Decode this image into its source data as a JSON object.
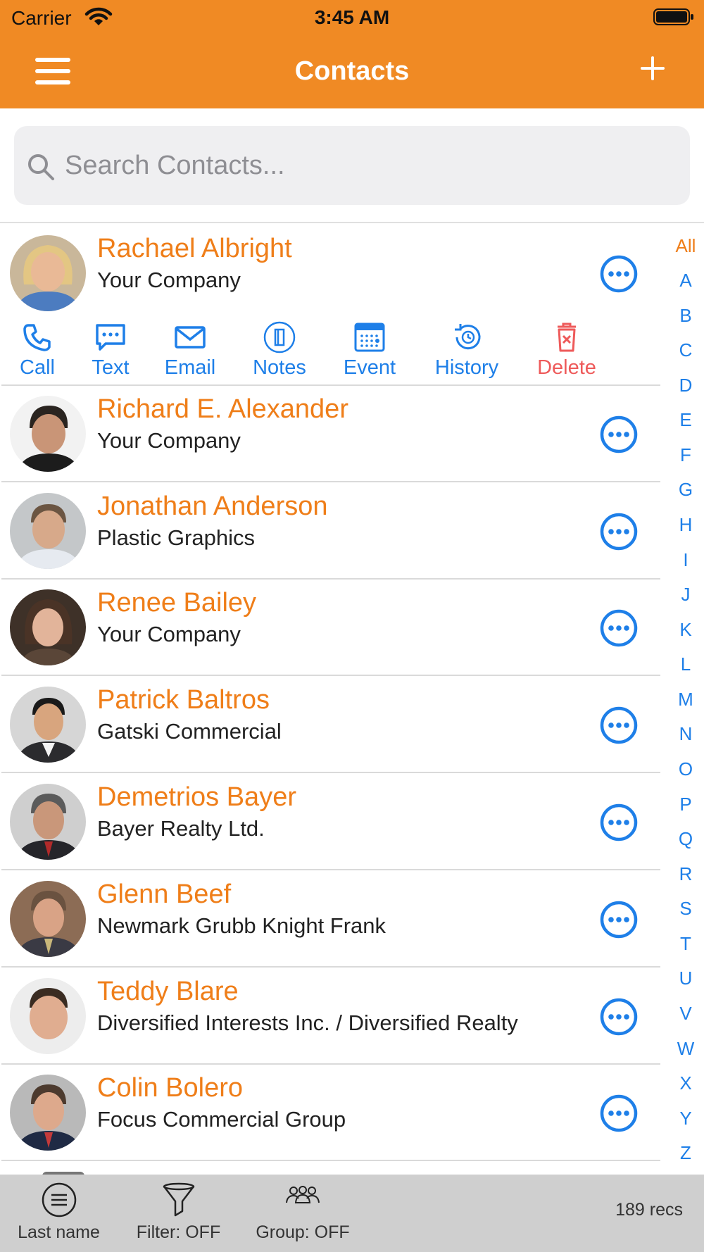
{
  "status_bar": {
    "carrier": "Carrier",
    "time": "3:45 AM"
  },
  "nav": {
    "title": "Contacts"
  },
  "search": {
    "placeholder": "Search Contacts..."
  },
  "expanded_actions": [
    {
      "label": "Call",
      "icon": "phone-icon"
    },
    {
      "label": "Text",
      "icon": "message-icon"
    },
    {
      "label": "Email",
      "icon": "envelope-icon"
    },
    {
      "label": "Notes",
      "icon": "notes-icon"
    },
    {
      "label": "Event",
      "icon": "calendar-icon"
    },
    {
      "label": "History",
      "icon": "history-icon"
    },
    {
      "label": "Delete",
      "icon": "trash-icon"
    }
  ],
  "contacts": [
    {
      "name": "Rachael Albright",
      "company": "Your Company"
    },
    {
      "name": "Richard E. Alexander",
      "company": "Your Company"
    },
    {
      "name": "Jonathan Anderson",
      "company": "Plastic Graphics"
    },
    {
      "name": "Renee Bailey",
      "company": "Your Company"
    },
    {
      "name": "Patrick Baltros",
      "company": "Gatski Commercial"
    },
    {
      "name": "Demetrios Bayer",
      "company": "Bayer Realty Ltd."
    },
    {
      "name": "Glenn Beef",
      "company": "Newmark Grubb Knight Frank"
    },
    {
      "name": "Teddy Blare",
      "company": "Diversified Interests Inc. / Diversified Realty"
    },
    {
      "name": "Colin Bolero",
      "company": "Focus Commercial Group"
    }
  ],
  "index": [
    "All",
    "A",
    "B",
    "C",
    "D",
    "E",
    "F",
    "G",
    "H",
    "I",
    "J",
    "K",
    "L",
    "M",
    "N",
    "O",
    "P",
    "Q",
    "R",
    "S",
    "T",
    "U",
    "V",
    "W",
    "X",
    "Y",
    "Z"
  ],
  "footer": {
    "sort_label": "Last name",
    "filter_label": "Filter: OFF",
    "group_label": "Group: OFF",
    "records": "189 recs"
  },
  "colors": {
    "header": "#F08A24",
    "name": "#EF7E19",
    "accent": "#1E7FE8",
    "delete": "#EE5A5A"
  }
}
